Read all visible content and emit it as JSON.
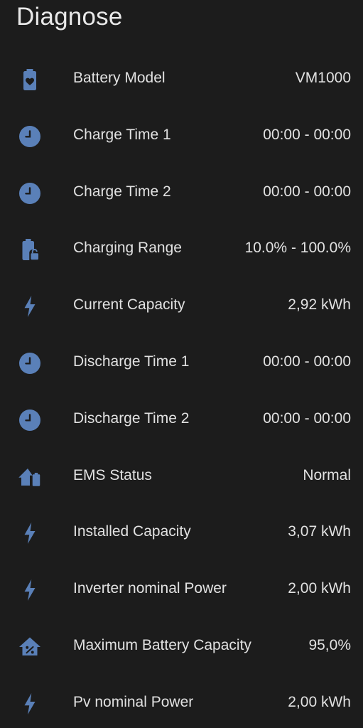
{
  "card": {
    "title": "Diagnose"
  },
  "colors": {
    "background": "#1c1c1c",
    "icon": "#5a80b8",
    "text": "#e1e1e1"
  },
  "entities": [
    {
      "icon": "battery-heart-icon",
      "label": "Battery Model",
      "value": "VM1000"
    },
    {
      "icon": "clock-icon",
      "label": "Charge Time 1",
      "value": "00:00 - 00:00"
    },
    {
      "icon": "clock-icon",
      "label": "Charge Time 2",
      "value": "00:00 - 00:00"
    },
    {
      "icon": "battery-lock-icon",
      "label": "Charging Range",
      "value": "10.0% - 100.0%"
    },
    {
      "icon": "lightning-bolt-icon",
      "label": "Current Capacity",
      "value": "2,92 kWh"
    },
    {
      "icon": "clock-icon",
      "label": "Discharge Time 1",
      "value": "00:00 - 00:00"
    },
    {
      "icon": "clock-icon",
      "label": "Discharge Time 2",
      "value": "00:00 - 00:00"
    },
    {
      "icon": "home-battery-icon",
      "label": "EMS Status",
      "value": "Normal"
    },
    {
      "icon": "lightning-bolt-icon",
      "label": "Installed Capacity",
      "value": "3,07 kWh"
    },
    {
      "icon": "lightning-bolt-icon",
      "label": "Inverter nominal Power",
      "value": "2,00 kWh"
    },
    {
      "icon": "home-percent-icon",
      "label": "Maximum Battery Capacity",
      "value": "95,0%"
    },
    {
      "icon": "lightning-bolt-icon",
      "label": "Pv nominal Power",
      "value": "2,00 kWh"
    }
  ]
}
